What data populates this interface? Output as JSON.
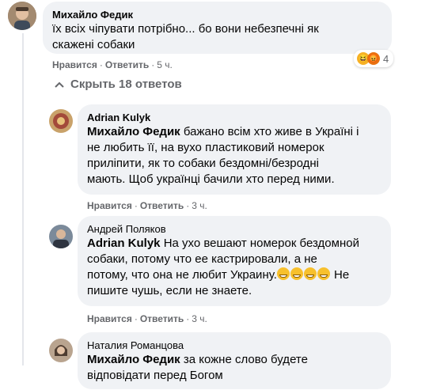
{
  "comments": [
    {
      "author": "Михайло Федик",
      "mention": "",
      "text_lines": [
        "їх всіх чіпувати потрібно... бо вони небезпечні як",
        "скажені собаки"
      ],
      "like": "Нравится",
      "reply": "Ответить",
      "time": "5 ч.",
      "reactions_count": "4"
    },
    {
      "author": "Adrian Kulyk",
      "mention": "Михайло Федик",
      "line1_rest": " бажано всім хто живе в Україні і",
      "text_lines": [
        "не любить її, на вухо пластиковий номерок",
        "приліпити, як то собаки бездомні/безродні",
        "мають. Щоб українці бачили хто перед ними."
      ],
      "like": "Нравится",
      "reply": "Ответить",
      "time": "3 ч."
    },
    {
      "author": "Андрей Поляков",
      "mention": "Adrian Kulyk",
      "line1_rest": " На ухо вешают номерок бездомной",
      "text_lines": [
        "собаки, потому что ее кастрировали, а не",
        "потому, что она не любит Украину.",
        "пишите чушь, если не знаете."
      ],
      "line3_tail": " Не",
      "like": "Нравится",
      "reply": "Ответить",
      "time": "3 ч."
    },
    {
      "author": "Наталия Романцова",
      "mention": "Михайло Федик",
      "line1_rest": " за кожне слово будете",
      "text_lines": [
        "відповідати перед Богом"
      ]
    }
  ],
  "replies_toggle": "Скрыть 18 ответов",
  "icons": {
    "angry": "angry-reaction-icon",
    "haha": "haha-reaction-icon",
    "chevron": "chevron-up-icon",
    "emoji": "grinning-emoji-icon"
  },
  "colors": {
    "bubble": "#f0f2f5",
    "meta": "#65676b",
    "angry": "#e9710f",
    "haha": "#f7b125"
  }
}
